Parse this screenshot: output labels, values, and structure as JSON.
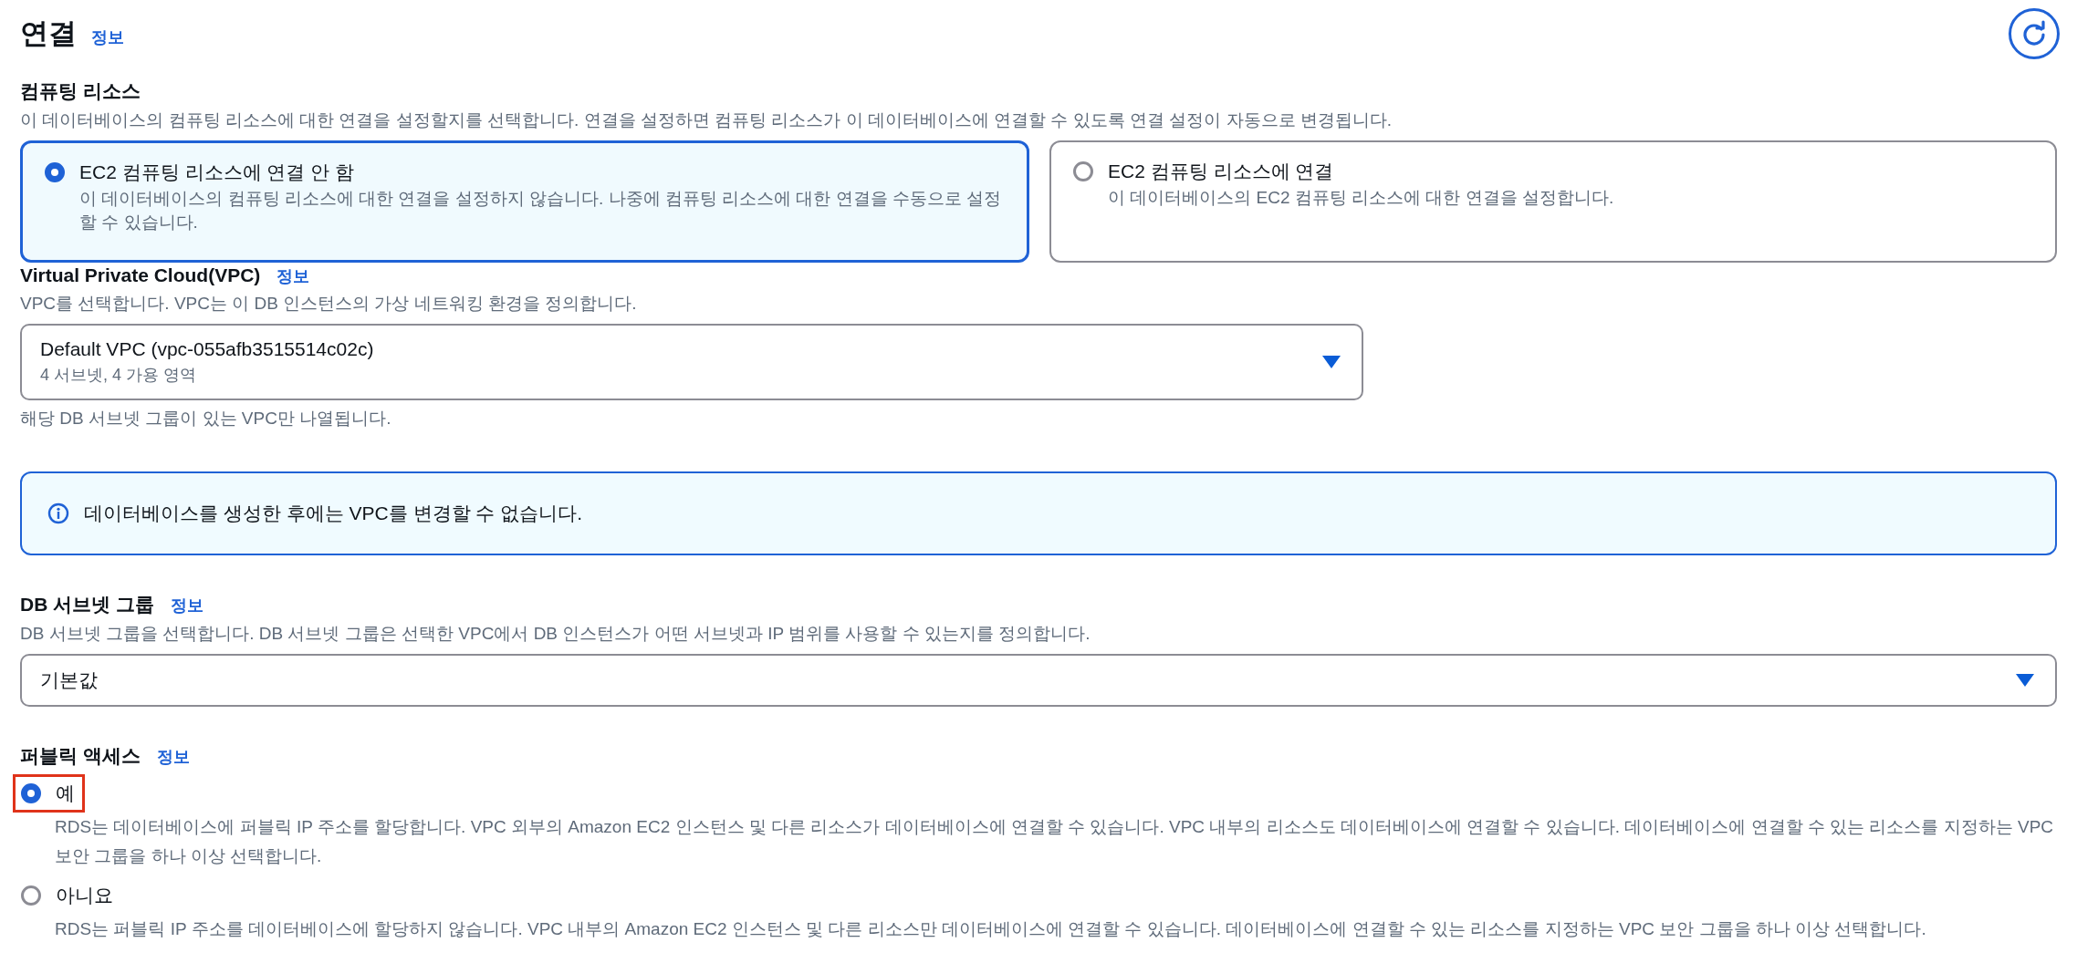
{
  "header": {
    "title": "연결",
    "info_link": "정보"
  },
  "compute_resource": {
    "label": "컴퓨팅 리소스",
    "description": "이 데이터베이스의 컴퓨팅 리소스에 대한 연결을 설정할지를 선택합니다. 연결을 설정하면 컴퓨팅 리소스가 이 데이터베이스에 연결할 수 있도록 연결 설정이 자동으로 변경됩니다.",
    "options": [
      {
        "label": "EC2 컴퓨팅 리소스에 연결 안 함",
        "description": "이 데이터베이스의 컴퓨팅 리소스에 대한 연결을 설정하지 않습니다. 나중에 컴퓨팅 리소스에 대한 연결을 수동으로 설정할 수 있습니다.",
        "selected": true
      },
      {
        "label": "EC2 컴퓨팅 리소스에 연결",
        "description": "이 데이터베이스의 EC2 컴퓨팅 리소스에 대한 연결을 설정합니다.",
        "selected": false
      }
    ]
  },
  "vpc": {
    "label": "Virtual Private Cloud(VPC)",
    "info_link": "정보",
    "description": "VPC를 선택합니다. VPC는 이 DB 인스턴스의 가상 네트워킹 환경을 정의합니다.",
    "value": "Default VPC (vpc-055afb3515514c02c)",
    "value_detail": "4 서브넷, 4 가용 영역",
    "hint": "해당 DB 서브넷 그룹이 있는 VPC만 나열됩니다."
  },
  "info_alert": {
    "text": "데이터베이스를 생성한 후에는 VPC를 변경할 수 없습니다."
  },
  "db_subnet_group": {
    "label": "DB 서브넷 그룹",
    "info_link": "정보",
    "description": "DB 서브넷 그룹을 선택합니다. DB 서브넷 그룹은 선택한 VPC에서 DB 인스턴스가 어떤 서브넷과 IP 범위를 사용할 수 있는지를 정의합니다.",
    "value": "기본값"
  },
  "public_access": {
    "label": "퍼블릭 액세스",
    "info_link": "정보",
    "options": [
      {
        "label": "예",
        "description": "RDS는 데이터베이스에 퍼블릭 IP 주소를 할당합니다. VPC 외부의 Amazon EC2 인스턴스 및 다른 리소스가 데이터베이스에 연결할 수 있습니다. VPC 내부의 리소스도 데이터베이스에 연결할 수 있습니다. 데이터베이스에 연결할 수 있는 리소스를 지정하는 VPC 보안 그룹을 하나 이상 선택합니다.",
        "selected": true,
        "highlighted": true
      },
      {
        "label": "아니요",
        "description": "RDS는 퍼블릭 IP 주소를 데이터베이스에 할당하지 않습니다. VPC 내부의 Amazon EC2 인스턴스 및 다른 리소스만 데이터베이스에 연결할 수 있습니다. 데이터베이스에 연결할 수 있는 리소스를 지정하는 VPC 보안 그룹을 하나 이상 선택합니다.",
        "selected": false,
        "highlighted": false
      }
    ]
  }
}
